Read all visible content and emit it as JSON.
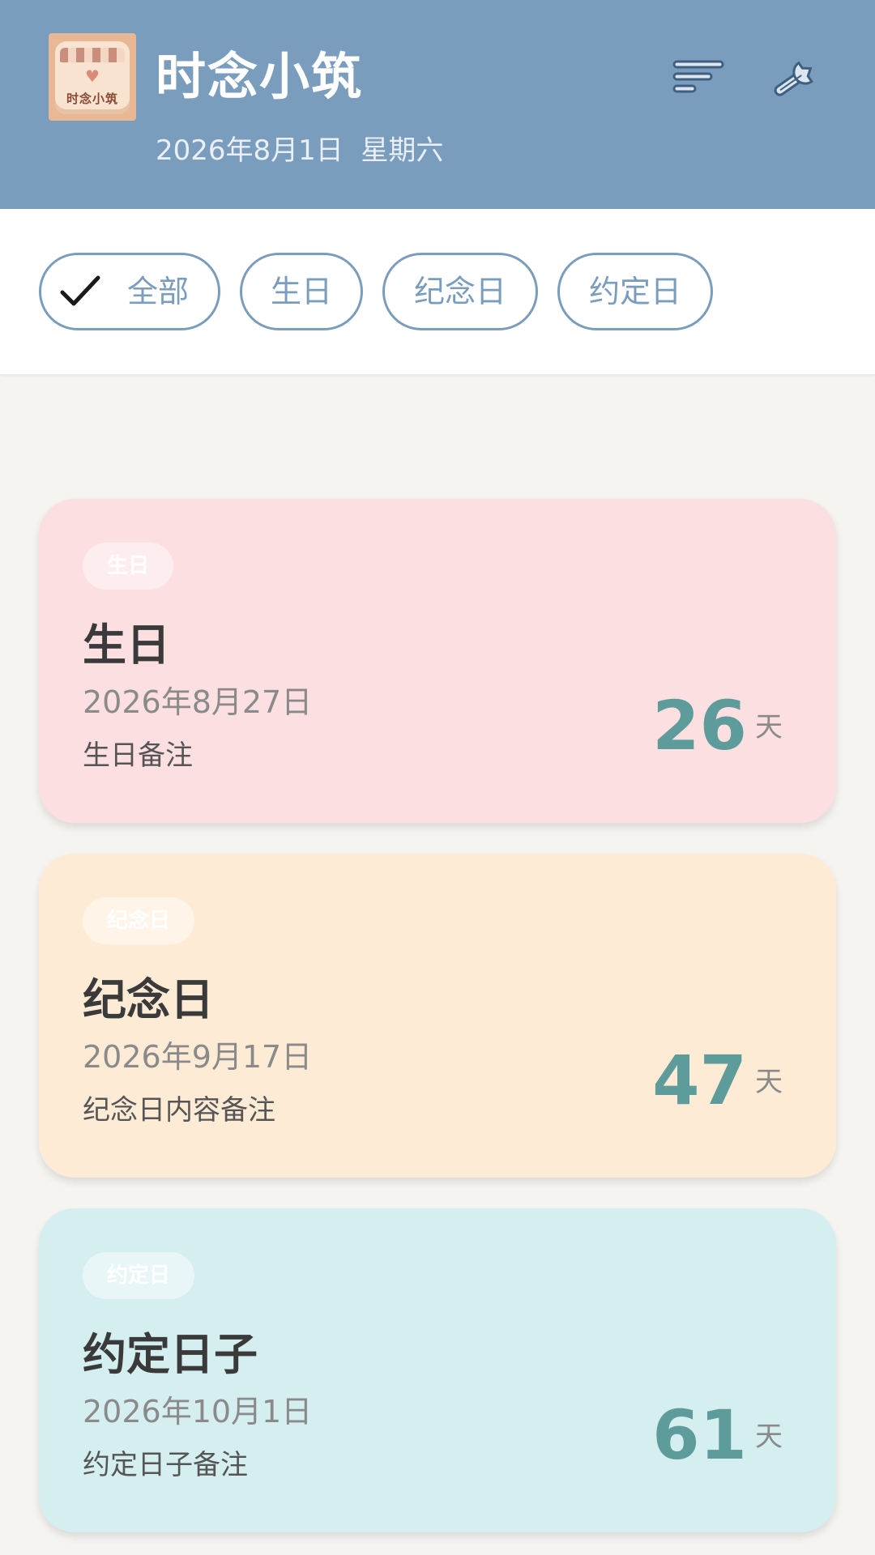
{
  "header": {
    "app_name": "时念小筑",
    "icon_text": "时念小筑",
    "date_line": "2026年8月1日  星期六",
    "bg_color": "#7b9dbd",
    "sort_icon": "sort-lines-icon",
    "settings_icon": "wrench-icon"
  },
  "filters": {
    "items": [
      {
        "label": "全部",
        "selected": true
      },
      {
        "label": "生日",
        "selected": false
      },
      {
        "label": "纪念日",
        "selected": false
      },
      {
        "label": "约定日",
        "selected": false
      }
    ],
    "accent_color": "#7b9dbd"
  },
  "cards": [
    {
      "tag": "生日",
      "title": "生日",
      "date": "2026年8月27日",
      "note": "生日备注",
      "days": "26",
      "unit": "天",
      "color": "#fcdfe1"
    },
    {
      "tag": "纪念日",
      "title": "纪念日",
      "date": "2026年9月17日",
      "note": "纪念日内容备注",
      "days": "47",
      "unit": "天",
      "color": "#feebd6"
    },
    {
      "tag": "约定日",
      "title": "约定日子",
      "date": "2026年10月1日",
      "note": "约定日子备注",
      "days": "61",
      "unit": "天",
      "color": "#d5eef0"
    }
  ],
  "count_color": "#5e9b9b"
}
